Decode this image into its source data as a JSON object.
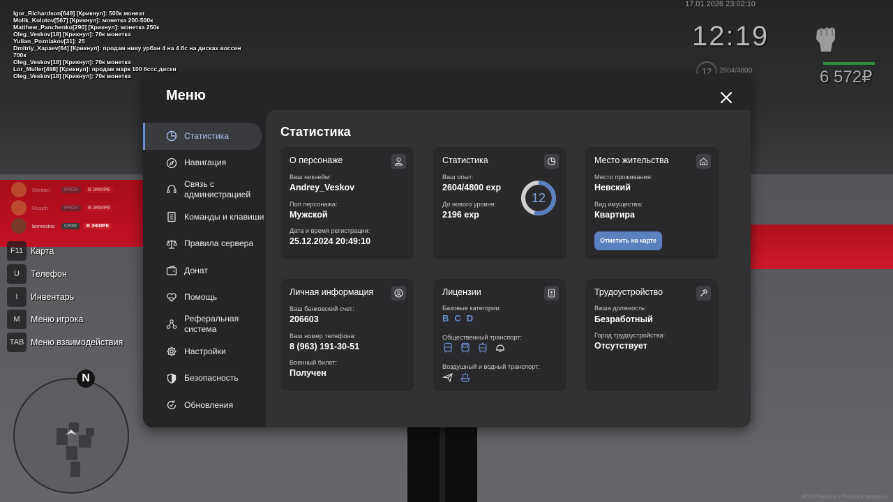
{
  "chat": [
    "Igor_Richardson[649] [Крикнул]: 500к монеат",
    "Molik_Kolotov[567] [Крикнул]: монетка 200-500к",
    "Matthew_Panchenko[290] [Крикнул]: монетка 250к",
    "Oleg_Veskov[18] [Крикнул]: 70к монетка",
    "Yulian_Pozniakov[31]: 25",
    "Dmitriy_Xapaev[64] [Крикнул]: продам ниву урбан 4 на 4 бс на дисках воссен",
    " 700к",
    "Oleg_Veskov[18] [Крикнул]: 70к монетка",
    "Lor_Muller[498] [Крикнул]: продам марк 100 6ссс,диски",
    "Oleg_Veskov[18] [Крикнул]: 70к монетка"
  ],
  "hud": {
    "date": "17.01.2026 23:02:10",
    "time": "12:19",
    "level": "12",
    "exp": "2604/4800",
    "money": "6 572₽",
    "health_fraction": 1.0,
    "health_color": "#2d8c3d",
    "fist_icon": "fist-icon"
  },
  "streamers": [
    {
      "name": "Gerdan",
      "tag": "PROV",
      "live": "В ЭФИРЕ",
      "active": false
    },
    {
      "name": "Rusich",
      "tag": "PROV",
      "live": "В ЭФИРЕ",
      "active": false
    },
    {
      "name": "bomestos",
      "tag": "CRIM",
      "live": "В ЭФИРЕ",
      "active": true
    }
  ],
  "keybinds": [
    {
      "key": "F11",
      "label": "Карта"
    },
    {
      "key": "U",
      "label": "Телефон"
    },
    {
      "key": "I",
      "label": "Инвентарь"
    },
    {
      "key": "M",
      "label": "Меню игрока"
    },
    {
      "key": "TAB",
      "label": "Меню взаимодействия"
    }
  ],
  "minimap": {
    "compass": "N"
  },
  "watermark": "MTA:Province • Province.mtasa.ru",
  "menu": {
    "title": "Меню",
    "accent": "#6c8fd0",
    "nav": [
      {
        "label": "Статистика",
        "icon": "pie-chart-icon",
        "active": true
      },
      {
        "label": "Навигация",
        "icon": "compass-icon",
        "active": false
      },
      {
        "label": "Связь с администрацией",
        "icon": "headset-icon",
        "active": false
      },
      {
        "label": "Команды и клавиши",
        "icon": "document-icon",
        "active": false
      },
      {
        "label": "Правила сервера",
        "icon": "scales-icon",
        "active": false
      },
      {
        "label": "Донат",
        "icon": "wallet-icon",
        "active": false
      },
      {
        "label": "Помощь",
        "icon": "heart-hand-icon",
        "active": false
      },
      {
        "label": "Реферальная система",
        "icon": "network-icon",
        "active": false
      },
      {
        "label": "Настройки",
        "icon": "gear-icon",
        "active": false
      },
      {
        "label": "Безопасность",
        "icon": "shield-icon",
        "active": false
      },
      {
        "label": "Обновления",
        "icon": "refresh-icon",
        "active": false
      }
    ],
    "content_title": "Статистика",
    "character": {
      "title": "О персонаже",
      "nick_label": "Ваш никнейм:",
      "nick": "Andrey_Veskov",
      "gender_label": "Пол персонажа:",
      "gender": "Мужской",
      "reg_label": "Дата и время регистрации:",
      "reg": "25.12.2024 20:49:10"
    },
    "stats": {
      "title": "Статистика",
      "exp_label": "Ваш опыт:",
      "exp": "2604/4800 exp",
      "next_label": "До нового уровня:",
      "next": "2196 exp",
      "level": "12",
      "level_progress": 0.5425
    },
    "residence": {
      "title": "Место жительства",
      "place_label": "Место проживания:",
      "place": "Невский",
      "prop_label": "Вид имущества:",
      "prop": "Квартира",
      "button": "Отметить на карте"
    },
    "personal": {
      "title": "Личная информация",
      "bank_label": "Ваш банковский счет:",
      "bank": "206603",
      "phone_label": "Ваш номер телефона:",
      "phone": "8 (963) 191-30-51",
      "military_label": "Военный билет:",
      "military": "Получен"
    },
    "licenses": {
      "title": "Лицензии",
      "base_label": "Базовые категории:",
      "categories": [
        "B",
        "C",
        "D"
      ],
      "public_label": "Общественный транспорт:",
      "public_icons": [
        "bus-icon",
        "bus-front-icon",
        "tram-icon",
        "helmet-icon"
      ],
      "air_label": "Воздушный и водный транспорт:",
      "air_icons": [
        "airplane-icon",
        "boat-icon"
      ]
    },
    "employment": {
      "title": "Трудоустройство",
      "pos_label": "Ваша должность:",
      "pos": "Безработный",
      "city_label": "Город трудоустройства:",
      "city": "Отсутствует"
    }
  }
}
